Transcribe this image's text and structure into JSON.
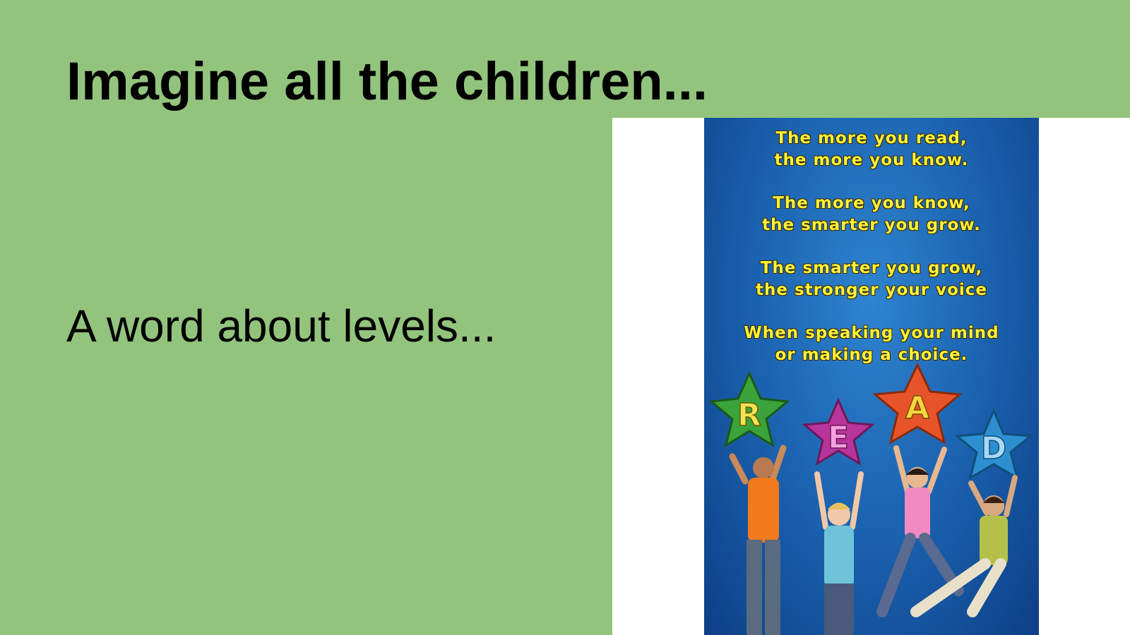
{
  "slide": {
    "title": "Imagine all the children...",
    "subtitle": "A word about levels...",
    "background_color": "#93c47d"
  },
  "poster": {
    "lines": [
      "The more you read,",
      "the more you know.",
      "The more you know,",
      "the smarter you grow.",
      "The smarter you grow,",
      "the stronger your voice",
      "When speaking your mind",
      "or making a choice."
    ],
    "stars": [
      {
        "letter": "R",
        "color": "#3aa33a"
      },
      {
        "letter": "E",
        "color": "#b8359b"
      },
      {
        "letter": "A",
        "color": "#e8542a"
      },
      {
        "letter": "D",
        "color": "#2d8fd0"
      }
    ]
  }
}
